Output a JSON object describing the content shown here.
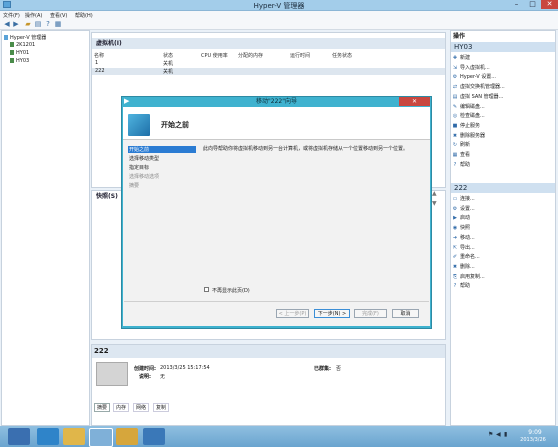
{
  "window": {
    "title": "Hyper-V 管理器",
    "min": "–",
    "max": "□",
    "close": "✕"
  },
  "menu": [
    "文件(F)",
    "操作(A)",
    "查看(V)",
    "帮助(H)"
  ],
  "tree": {
    "root": "Hyper-V 管理器",
    "servers": [
      "2K1201",
      "HY01",
      "HY03"
    ]
  },
  "vm_panel": {
    "title": "虚拟机(I)",
    "columns": [
      "名称",
      "状态",
      "CPU 使用率",
      "分配的内存",
      "运行时间",
      "任务状态"
    ],
    "rows": [
      {
        "name": "1",
        "state": "关机"
      },
      {
        "name": "222",
        "state": "关机"
      }
    ]
  },
  "snapshot_panel": {
    "title": "快照(S)"
  },
  "details": {
    "vm_name": "222",
    "created_label": "创建时间:",
    "created_value": "2013/3/25 15:17:54",
    "notes_label": "说明:",
    "notes_value": "无",
    "clustered_label": "已群集:",
    "clustered_value": "否",
    "tabs": [
      "摘要",
      "内存",
      "网络",
      "复制"
    ]
  },
  "actions": {
    "header": "操作",
    "host_section": "HY03",
    "host_items": [
      {
        "label": "新建",
        "icon": "new-icon"
      },
      {
        "label": "导入虚拟机...",
        "icon": "import-icon"
      },
      {
        "label": "Hyper-V 设置...",
        "icon": "settings-icon"
      },
      {
        "label": "虚拟交换机管理器...",
        "icon": "switch-icon"
      },
      {
        "label": "虚拟 SAN 管理器...",
        "icon": "san-icon"
      },
      {
        "label": "编辑磁盘...",
        "icon": "edit-disk-icon"
      },
      {
        "label": "检查磁盘...",
        "icon": "inspect-disk-icon"
      },
      {
        "label": "停止服务",
        "icon": "stop-icon"
      },
      {
        "label": "删除服务器",
        "icon": "delete-icon"
      },
      {
        "label": "刷新",
        "icon": "refresh-icon"
      },
      {
        "label": "查看",
        "icon": "view-icon"
      },
      {
        "label": "帮助",
        "icon": "help-icon"
      }
    ],
    "vm_section": "222",
    "vm_items": [
      {
        "label": "连接...",
        "icon": "connect-icon"
      },
      {
        "label": "设置...",
        "icon": "settings-icon"
      },
      {
        "label": "启动",
        "icon": "start-icon"
      },
      {
        "label": "快照",
        "icon": "snapshot-icon"
      },
      {
        "label": "移动...",
        "icon": "move-icon"
      },
      {
        "label": "导出...",
        "icon": "export-icon"
      },
      {
        "label": "重命名...",
        "icon": "rename-icon"
      },
      {
        "label": "删除...",
        "icon": "delete-icon"
      },
      {
        "label": "启用复制...",
        "icon": "replicate-icon"
      },
      {
        "label": "帮助",
        "icon": "help-icon"
      }
    ]
  },
  "dialog": {
    "title": "移动\"222\"向导",
    "heading": "开始之前",
    "steps": [
      "开始之前",
      "选择移动类型",
      "指定目标",
      "选择移动选项",
      "摘要"
    ],
    "description": "此向导帮助你将虚拟机移动到另一台计算机，或将虚拟机存储从一个位置移动到另一个位置。",
    "checkbox_label": "不再显示此页(D)",
    "buttons": {
      "prev": "< 上一步(P)",
      "next": "下一步(N) >",
      "finish": "完成(F)",
      "cancel": "取消"
    }
  },
  "taskbar": {
    "time": "9:09",
    "date": "2013/3/26"
  },
  "colors": {
    "accent": "#3fb2cf",
    "selection": "#2b7cd3",
    "close": "#c9473f"
  }
}
